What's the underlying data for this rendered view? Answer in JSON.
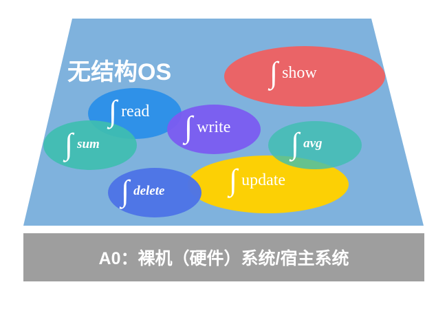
{
  "title": "无结构OS",
  "integral_symbol": "∫",
  "functions": [
    {
      "id": "show",
      "label": "show",
      "style": "serif",
      "color": "#f06060"
    },
    {
      "id": "read",
      "label": "read",
      "style": "serif",
      "color": "#2b8fe8"
    },
    {
      "id": "write",
      "label": "write",
      "style": "serif",
      "color": "#7b5cf0"
    },
    {
      "id": "sum",
      "label": "sum",
      "style": "bold-italic",
      "color": "#3fbeb0"
    },
    {
      "id": "avg",
      "label": "avg",
      "style": "bold-italic",
      "color": "#3fbeb0"
    },
    {
      "id": "update",
      "label": "update",
      "style": "serif",
      "color": "#ffd000"
    },
    {
      "id": "delete",
      "label": "delete",
      "style": "bold-italic",
      "color": "#4f74e6"
    }
  ],
  "base_layer": {
    "label": "A0：裸机（硬件）系统/宿主系统",
    "color": "#9e9e9e"
  },
  "os_plane_color": "#7fb2dd"
}
